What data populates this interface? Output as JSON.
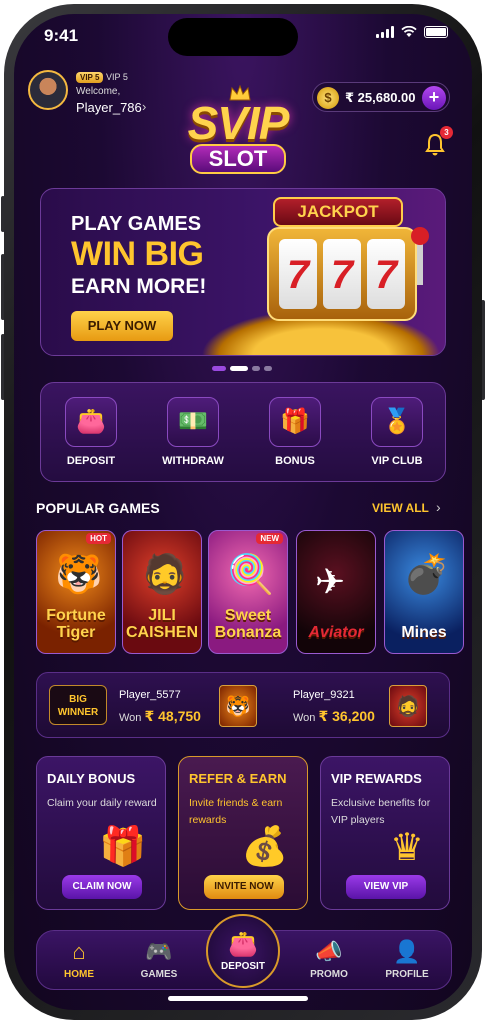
{
  "status_bar": {
    "time": "9:41"
  },
  "header": {
    "vip_badge": "VIP 5",
    "vip_level": "VIP 5",
    "welcome": "Welcome,",
    "username": "Player_786",
    "balance": "₹ 25,680.00",
    "notification_count": "3"
  },
  "logo": {
    "top": "SVIP",
    "bottom": "SLOT"
  },
  "banner": {
    "line1": "PLAY GAMES",
    "line2": "WIN BIG",
    "line3": "EARN MORE!",
    "button": "PLAY NOW",
    "jackpot": "JACKPOT",
    "reels": [
      "7",
      "7",
      "7"
    ]
  },
  "quick_actions": [
    {
      "label": "DEPOSIT",
      "icon": "wallet-icon"
    },
    {
      "label": "WITHDRAW",
      "icon": "cash-up-icon"
    },
    {
      "label": "BONUS",
      "icon": "gift-icon"
    },
    {
      "label": "VIP CLUB",
      "icon": "vip-medal-icon"
    }
  ],
  "popular": {
    "title": "POPULAR GAMES",
    "view_all": "VIEW ALL",
    "games": [
      {
        "name": "Fortune Tiger",
        "tag": "HOT"
      },
      {
        "name": "JILI CAISHEN",
        "tag": ""
      },
      {
        "name": "Sweet Bonanza",
        "tag": "NEW"
      },
      {
        "name": "Aviator",
        "tag": ""
      },
      {
        "name": "Mines",
        "tag": ""
      }
    ]
  },
  "winners": {
    "label_line1": "BIG",
    "label_line2": "WINNER",
    "items": [
      {
        "player": "Player_5577",
        "won_label": "Won",
        "amount": "₹ 48,750",
        "game": "Fortune Tiger"
      },
      {
        "player": "Player_9321",
        "won_label": "Won",
        "amount": "₹ 36,200",
        "game": "JILI CAISHEN"
      }
    ]
  },
  "promos": [
    {
      "title": "DAILY BONUS",
      "desc": "Claim your daily reward",
      "button": "CLAIM NOW"
    },
    {
      "title": "REFER & EARN",
      "desc": "Invite friends & earn rewards",
      "button": "INVITE NOW"
    },
    {
      "title": "VIP REWARDS",
      "desc": "Exclusive benefits for VIP players",
      "button": "VIEW VIP"
    }
  ],
  "nav": {
    "home": "HOME",
    "games": "GAMES",
    "deposit": "DEPOSIT",
    "promo": "PROMO",
    "profile": "PROFILE",
    "active": "home"
  },
  "colors": {
    "accent_gold": "#ffc52e",
    "bg_purple": "#1c0933",
    "button_purple": "#7a1fd0"
  }
}
